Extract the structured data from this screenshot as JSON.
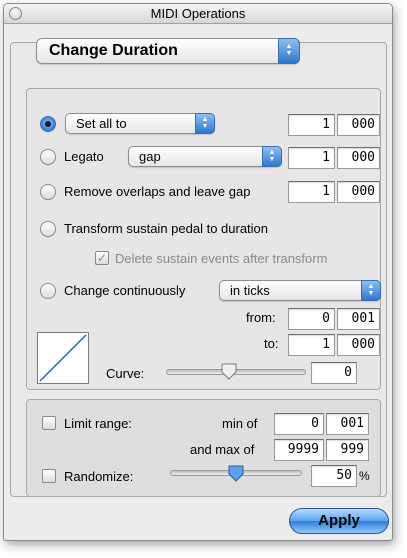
{
  "window": {
    "title": "MIDI Operations"
  },
  "operation": {
    "selected": "Change Duration"
  },
  "set_all": {
    "selected": "Set all to",
    "field_a": "1",
    "field_b": "000"
  },
  "legato": {
    "label": "Legato",
    "selected": "gap",
    "field_a": "1",
    "field_b": "000"
  },
  "remove_overlaps": {
    "label": "Remove overlaps and leave gap",
    "field_a": "1",
    "field_b": "000"
  },
  "transform_sustain": {
    "label": "Transform sustain pedal to duration"
  },
  "delete_sustain": {
    "label": "Delete sustain events after transform",
    "checked": true,
    "enabled": false
  },
  "change_continuously": {
    "label": "Change continuously",
    "selected": "in ticks",
    "from_label": "from:",
    "from_a": "0",
    "from_b": "001",
    "to_label": "to:",
    "to_a": "1",
    "to_b": "000",
    "curve_label": "Curve:",
    "curve_value": "0",
    "curve_position": 0.45
  },
  "limit_range": {
    "label": "Limit range:",
    "min_label": "min of",
    "min_a": "0",
    "min_b": "001",
    "max_label": "and max of",
    "max_a": "9999",
    "max_b": "999"
  },
  "randomize": {
    "label": "Randomize:",
    "value": "50",
    "unit": "%",
    "slider_position": 0.5
  },
  "buttons": {
    "apply": "Apply"
  },
  "colors": {
    "accent": "#2f78d6",
    "window_bg": "#ececec"
  }
}
